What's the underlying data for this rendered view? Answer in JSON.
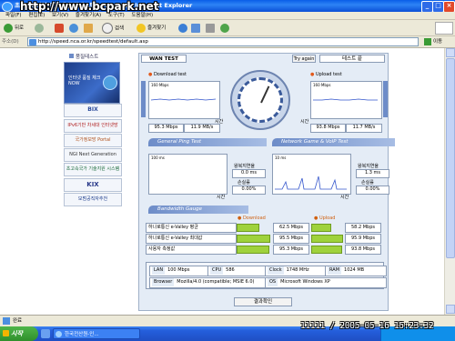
{
  "window": {
    "title": "초고속국가망 인터넷 품질테스트 - Microsoft Internet Explorer",
    "watermark": "http://www.bcpark.net"
  },
  "menubar": {
    "items": [
      "파일(F)",
      "편집(E)",
      "보기(V)",
      "즐겨찾기(A)",
      "도구(T)",
      "도움말(H)"
    ]
  },
  "toolbar": {
    "back": "뒤로",
    "search": "검색",
    "favorites": "즐겨찾기"
  },
  "address": {
    "label": "주소(D)",
    "url": "http://speed.nca.or.kr/speedtest/default.asp",
    "go": "이동"
  },
  "sidebar": {
    "heading": "품질테스트",
    "items": [
      "BIX",
      "IPv6기반 차세대 인터넷망",
      "국가정보망 Portal",
      "NGI Next Generation",
      "초고속국가 기술지원 시스템",
      "KIX",
      "모범공직자추천"
    ],
    "banner_text": "인터넷 품질 체크 NOW"
  },
  "panel": {
    "tab": "WAN TEST",
    "try_again": "Try again",
    "test_button": "테스트 끝",
    "download": {
      "title": "Download test",
      "scale": "160 Mbps",
      "mbps": "95.3 Mbps",
      "mbs": "11.9 MB/s",
      "time": "시간"
    },
    "upload": {
      "title": "Upload test",
      "scale": "160 Mbps",
      "mbps": "93.8 Mbps",
      "mbs": "11.7 MB/s",
      "time": "시간"
    },
    "ping": {
      "title": "General Ping Test",
      "scale": "100 ms",
      "delay_label": "왕복지연율",
      "delay": "0.0 ms",
      "loss_label": "손실률",
      "loss": "0.00%",
      "time": "시간"
    },
    "game": {
      "title": "Network Game & VoIP Test",
      "scale": "10 ms",
      "delay_label": "왕복지연율",
      "delay": "1.3 ms",
      "loss_label": "손실률",
      "loss": "0.00%",
      "time": "시간"
    },
    "bandwidth": {
      "title": "Bandwidth Gauge",
      "download_label": "Download",
      "upload_label": "Upload",
      "rows": [
        {
          "name": "하나로통신 e-Valley 평균",
          "down": "62.5 Mbps",
          "down_frac": 0.63,
          "up": "58.2 Mbps",
          "up_frac": 0.58
        },
        {
          "name": "하나로통신 e-Valley 최대값",
          "down": "95.5 Mbps",
          "down_frac": 0.96,
          "up": "95.9 Mbps",
          "up_frac": 0.96
        },
        {
          "name": "사용자 측정값",
          "down": "95.3 Mbps",
          "down_frac": 0.95,
          "up": "93.8 Mbps",
          "up_frac": 0.94
        }
      ]
    },
    "system": {
      "lan_label": "LAN",
      "lan": "100 Mbps",
      "cpu_label": "CPU",
      "cpu": "586",
      "clock_label": "Clock",
      "clock": "1748 MHz",
      "ram_label": "RAM",
      "ram": "1024 MB",
      "browser_label": "Browser",
      "browser": "Mozilla/4.0 (compatible; MSIE 6.0)",
      "os_label": "OS",
      "os": "Microsoft Windows XP"
    },
    "confirm": "결과확인"
  },
  "statusbar": {
    "text": "완료"
  },
  "taskbar": {
    "start": "시작",
    "item": "한국전산원-인..."
  },
  "datestamp": "11111 / 2005-05-16 15:23:32"
}
